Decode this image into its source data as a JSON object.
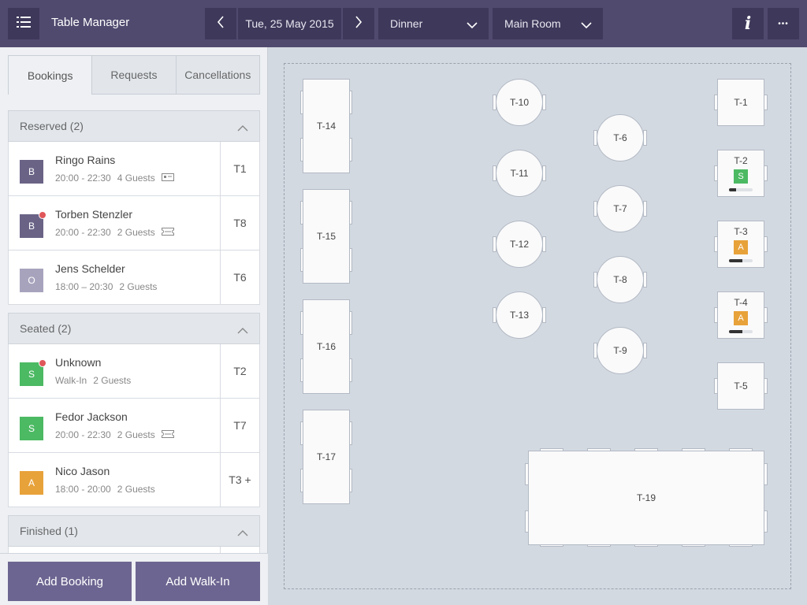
{
  "app": {
    "title": "Table Manager"
  },
  "header": {
    "date": "Tue, 25 May 2015",
    "meal": "Dinner",
    "room": "Main Room",
    "info_label": "i",
    "more_label": "•••"
  },
  "tabs": [
    "Bookings",
    "Requests",
    "Cancellations"
  ],
  "sections": {
    "reserved": {
      "title": "Reserved (2)",
      "items": [
        {
          "initial": "B",
          "name": "Ringo Rains",
          "time": "20:00 - 22:30",
          "guests": "4 Guests",
          "table": "T1"
        },
        {
          "initial": "B",
          "name": "Torben Stenzler",
          "time": "20:00 - 22:30",
          "guests": "2 Guests",
          "table": "T8"
        },
        {
          "initial": "O",
          "name": "Jens Schelder",
          "time": "18:00 – 20:30",
          "guests": "2 Guests",
          "table": "T6"
        }
      ]
    },
    "seated": {
      "title": "Seated (2)",
      "items": [
        {
          "initial": "S",
          "name": "Unknown",
          "time": "Walk-In",
          "guests": "2 Guests",
          "table": "T2"
        },
        {
          "initial": "S",
          "name": "Fedor Jackson",
          "time": "20:00 - 22:30",
          "guests": "2 Guests",
          "table": "T7"
        },
        {
          "initial": "A",
          "name": "Nico Jason",
          "time": "18:00 - 20:00",
          "guests": "2 Guests",
          "table": "T3 +"
        }
      ]
    },
    "finished": {
      "title": "Finished (1)"
    }
  },
  "actions": {
    "add_booking": "Add Booking",
    "add_walkin": "Add Walk-In"
  },
  "colors": {
    "header_bg": "#514a6f",
    "button_bg": "#6d6591",
    "status_b": "#6a6386",
    "status_o": "#a8a3bd",
    "status_s": "#4cb963",
    "status_a": "#e8a23a",
    "notification": "#e0575a"
  },
  "floor": {
    "tables": {
      "t1": "T-1",
      "t2": "T-2",
      "t3": "T-3",
      "t4": "T-4",
      "t5": "T-5",
      "t6": "T-6",
      "t7": "T-7",
      "t8": "T-8",
      "t9": "T-9",
      "t10": "T-10",
      "t11": "T-11",
      "t12": "T-12",
      "t13": "T-13",
      "t14": "T-14",
      "t15": "T-15",
      "t16": "T-16",
      "t17": "T-17",
      "t19": "T-19"
    },
    "status": {
      "t2": {
        "badge": "S",
        "progress": 0.3
      },
      "t3": {
        "badge": "A",
        "progress": 0.55
      },
      "t4": {
        "badge": "A",
        "progress": 0.55
      }
    }
  }
}
